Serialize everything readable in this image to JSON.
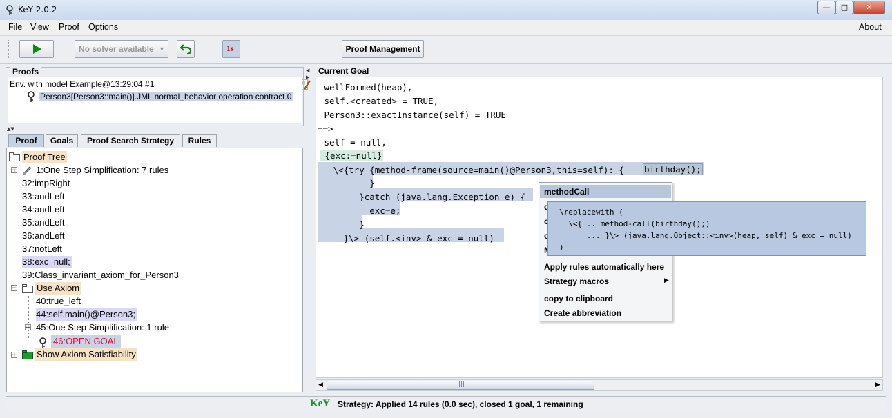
{
  "window": {
    "title": "KeY 2.0.2",
    "btn_min": "—",
    "btn_max": "□",
    "btn_close": "✕"
  },
  "menu": {
    "file": "File",
    "view": "View",
    "proof": "Proof",
    "options": "Options",
    "about": "About"
  },
  "toolbar": {
    "solver": "No solver available",
    "proof_management": "Proof Management",
    "one_step_badge": "1s"
  },
  "proofs_panel": {
    "title": "Proofs",
    "env": "Env. with model Example@13:29:04 #1",
    "contract": "Person3[Person3::main()].JML normal_behavior operation contract.0"
  },
  "tabs": [
    "Proof",
    "Goals",
    "Proof Search Strategy",
    "Rules"
  ],
  "tree": {
    "root": "Proof Tree",
    "n1": "1:One Step Simplification: 7 rules",
    "n32": "32:impRight",
    "n33": "33:andLeft",
    "n34": "34:andLeft",
    "n35": "35:andLeft",
    "n36": "36:andLeft",
    "n37": "37:notLeft",
    "n38": "38:exc=null;",
    "n39": "39:Class_invariant_axiom_for_Person3",
    "use_axiom": "Use Axiom",
    "n40": "40:true_left",
    "n44": "44:self.main()@Person3;",
    "n45": "45:One Step Simplification: 1 rule",
    "n46": "46:OPEN GOAL",
    "show_axiom": "Show Axiom Satisfiability"
  },
  "goal": {
    "title": "Current Goal",
    "l1": " wellFormed(heap),",
    "l2": " self.<created> = TRUE,",
    "l3": " Person3::exactInstance(self) = TRUE",
    "l4": "==>",
    "l5": " self = null,",
    "l6": " {exc:=null}",
    "l7a": "   \\<{try {method-frame(source=main()@Person3,this=self): {",
    "l7b": "birthday();",
    "l8": "          }",
    "l9": "        }catch (java.lang.Exception e) {",
    "l10": "          exc=e;",
    "l11": "        }",
    "l12": "     }\\> (self.<inv> & exc = null)"
  },
  "context_menu": {
    "header": "methodCall",
    "hidden_letters": [
      "d",
      "c",
      "c",
      "M"
    ],
    "apply_auto": "Apply rules automatically here",
    "strategy_macros": "Strategy macros",
    "copy": "copy to clipboard",
    "abbrev": "Create abbreviation"
  },
  "tooltip": {
    "l1": "\\replacewith (",
    "l2": "  \\<{ .. method-call(birthday();)",
    "l3": "      ... }\\> (java.lang.Object::<inv>(heap, self) & exc = null)",
    "l4": ")"
  },
  "status": {
    "logo": "KeY",
    "text": "Strategy: Applied 14 rules (0.0 sec), closed 1 goal, 1 remaining"
  },
  "colors": {
    "accent": "#c4d2e3",
    "open_goal": "#e0102c",
    "goal_hl": "#c8d4e6",
    "node_tan": "#f6e2c4",
    "node_lav": "#d9d9f6"
  }
}
